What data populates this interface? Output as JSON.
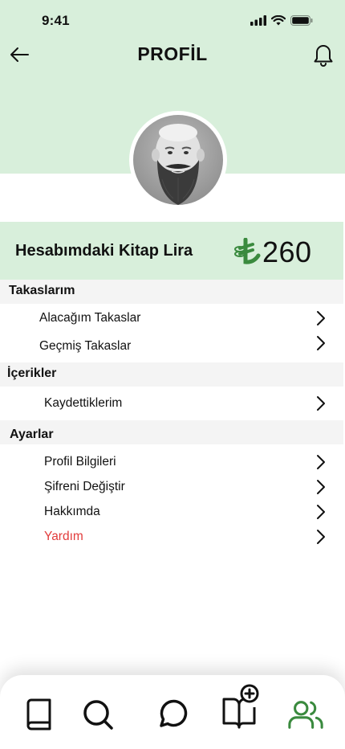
{
  "status_bar": {
    "time": "9:41"
  },
  "header": {
    "title": "PROFİL"
  },
  "balance": {
    "label": "Hesabımdaki Kitap Lira",
    "value": "260"
  },
  "sections": {
    "trades": {
      "title": "Takaslarım",
      "items": [
        {
          "label": "Alacağım Takaslar"
        },
        {
          "label": "Geçmiş Takaslar"
        }
      ]
    },
    "contents": {
      "title": "İçerikler",
      "items": [
        {
          "label": "Kaydettiklerim"
        }
      ]
    },
    "settings": {
      "title": "Ayarlar",
      "items": [
        {
          "label": "Profil Bilgileri"
        },
        {
          "label": "Şifreni Değiştir"
        },
        {
          "label": "Hakkımda"
        },
        {
          "label": "Yardım",
          "color": "#e23b3b"
        }
      ]
    }
  },
  "bottom_nav": {
    "items": [
      {
        "icon": "book-icon"
      },
      {
        "icon": "search-icon"
      },
      {
        "icon": "chat-icon"
      },
      {
        "icon": "add-book-icon"
      },
      {
        "icon": "users-icon",
        "active": true
      }
    ]
  },
  "colors": {
    "header_bg": "#d8efdb",
    "accent_green": "#3a8a3e",
    "danger": "#e23b3b"
  }
}
